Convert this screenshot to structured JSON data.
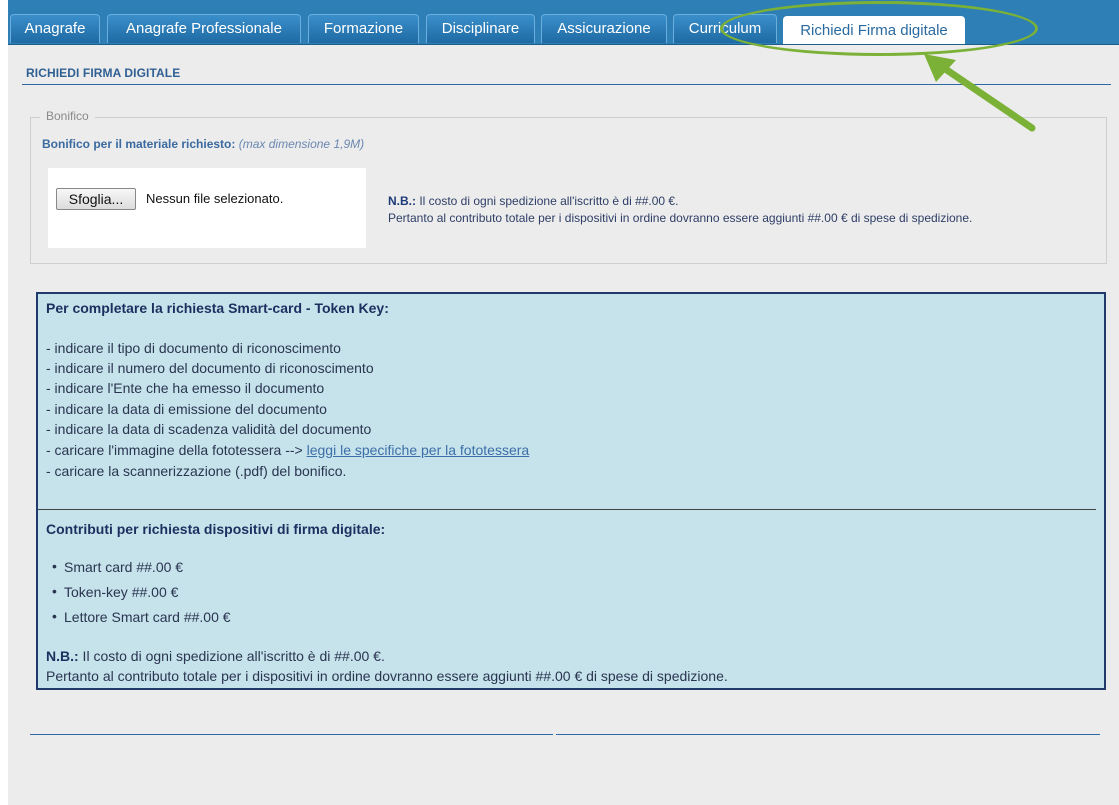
{
  "tabs": [
    {
      "label": "Anagrafe",
      "active": false
    },
    {
      "label": "Anagrafe Professionale",
      "active": false
    },
    {
      "label": "Formazione",
      "active": false
    },
    {
      "label": "Disciplinare",
      "active": false
    },
    {
      "label": "Assicurazione",
      "active": false
    },
    {
      "label": "Curriculum",
      "active": false
    },
    {
      "label": "Richiedi Firma digitale",
      "active": true
    }
  ],
  "section": {
    "title": "RICHIEDI FIRMA DIGITALE"
  },
  "bonifico": {
    "legend": "Bonifico",
    "label": "Bonifico per il materiale richiesto:",
    "hint": "(max dimensione 1,9M)",
    "browse_label": "Sfoglia...",
    "file_status": "Nessun file selezionato.",
    "nb_label": "N.B.:",
    "nb_line1": " Il costo di ogni spedizione all'iscritto è di ##.00 €.",
    "nb_line2": "Pertanto al contributo totale per i dispositivi in ordine dovranno essere aggiunti ##.00 € di spese di spedizione."
  },
  "info": {
    "heading": "Per completare la richiesta Smart-card - Token Key:",
    "steps": [
      "- indicare il tipo di documento di riconoscimento",
      "- indicare il numero del documento di riconoscimento",
      "- indicare l'Ente che ha emesso il documento",
      "- indicare la data di emissione del documento",
      "- indicare la data di scadenza validità del documento",
      "- caricare l'immagine della fototessera --> ",
      "- caricare la scannerizzazione (.pdf) del bonifico."
    ],
    "photo_link": "leggi le specifiche per la fototessera",
    "contrib_heading": "Contributi per richiesta dispositivi di firma digitale:",
    "contrib_items": [
      "Smart card ##.00 €",
      "Token-key ##.00 €",
      "Lettore Smart card ##.00 €"
    ],
    "nb_label": "N.B.:",
    "nb_line1": " Il costo di ogni spedizione all'iscritto è di ##.00 €.",
    "nb_line2": "Pertanto al contributo totale per i dispositivi in ordine dovranno essere aggiunti ##.00 € di spese di spedizione."
  },
  "annotation": {
    "color": "#7bb136"
  }
}
